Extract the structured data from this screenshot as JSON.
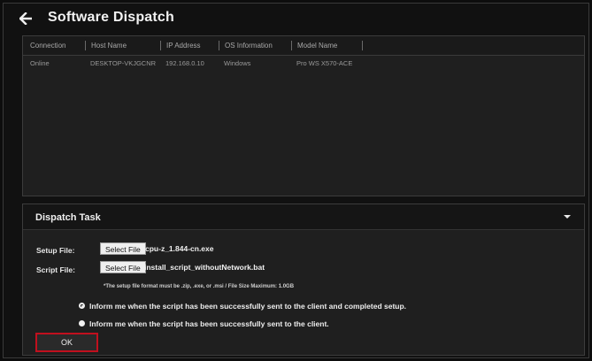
{
  "page": {
    "title": "Software Dispatch"
  },
  "table": {
    "columns": [
      "Connection",
      "Host Name",
      "IP Address",
      "OS Information",
      "Model Name"
    ],
    "rows": [
      [
        "Online",
        "DESKTOP-VKJGCNR",
        "192.168.0.10",
        "Windows",
        "Pro WS X570-ACE"
      ]
    ]
  },
  "task": {
    "title": "Dispatch Task",
    "setup_file": {
      "label": "Setup File:",
      "button": "Select File",
      "value": "cpu-z_1.844-cn.exe"
    },
    "script_file": {
      "label": "Script File:",
      "button": "Select File",
      "value": "install_script_withoutNetwork.bat"
    },
    "hint": "*The setup file format must be .zip, .exe, or .msi  /  File Size Maximum: 1.0GB",
    "options": [
      {
        "label": "Inform me when the script has been successfully sent to the client and completed setup.",
        "checked": true
      },
      {
        "label": "Inform me when the script has been successfully sent to the client.",
        "checked": false
      }
    ],
    "ok_label": "OK"
  },
  "colors": {
    "ok_border": "#c1101e",
    "background": "#111111",
    "panel": "#1f1f1f"
  }
}
